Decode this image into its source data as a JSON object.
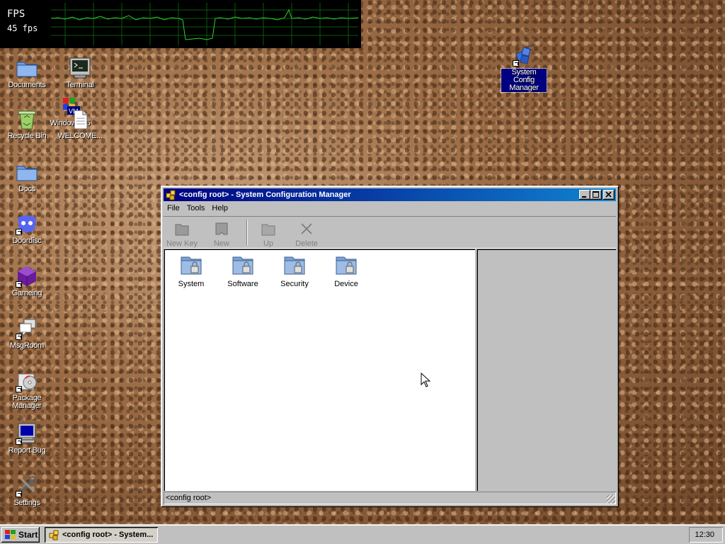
{
  "fps_widget": {
    "label": "FPS",
    "value": "45 fps"
  },
  "desktop_icons": [
    {
      "label": "Documents",
      "icon": "folder-icon"
    },
    {
      "label": "Terminal",
      "icon": "terminal-icon"
    },
    {
      "label": "Recycle Bin",
      "icon": "recycle-bin-icon"
    },
    {
      "label": "Windows 95",
      "icon": "windows95-icon",
      "badge": "VM"
    },
    {
      "label": "WELCOME...",
      "icon": "document-icon"
    },
    {
      "label": "Docs",
      "icon": "folder-icon"
    },
    {
      "label": "Doordisc",
      "icon": "chat-icon"
    },
    {
      "label": "Gameing",
      "icon": "game-cube-icon"
    },
    {
      "label": "MsgRoom",
      "icon": "messages-icon"
    },
    {
      "label": "Package Manager",
      "icon": "package-icon"
    },
    {
      "label": "Report Bug",
      "icon": "computer-icon"
    },
    {
      "label": "Settings",
      "icon": "settings-tools-icon"
    },
    {
      "label": "System Config Manager",
      "icon": "registry-icon",
      "selected": true
    }
  ],
  "window": {
    "title": "<config root> - System Configuration Manager",
    "menu": [
      "File",
      "Tools",
      "Help"
    ],
    "toolbar": [
      "New Key",
      "New Value",
      "Up",
      "Delete"
    ],
    "keys": [
      "System",
      "Software",
      "Security",
      "Device"
    ],
    "status": "<config root>"
  },
  "taskbar": {
    "start_label": "Start",
    "task_label": "<config root> - System...",
    "clock": "12:30"
  },
  "colors": {
    "titlebar_start": "#000080",
    "titlebar_end": "#1084d0",
    "face": "#c0c0c0"
  }
}
